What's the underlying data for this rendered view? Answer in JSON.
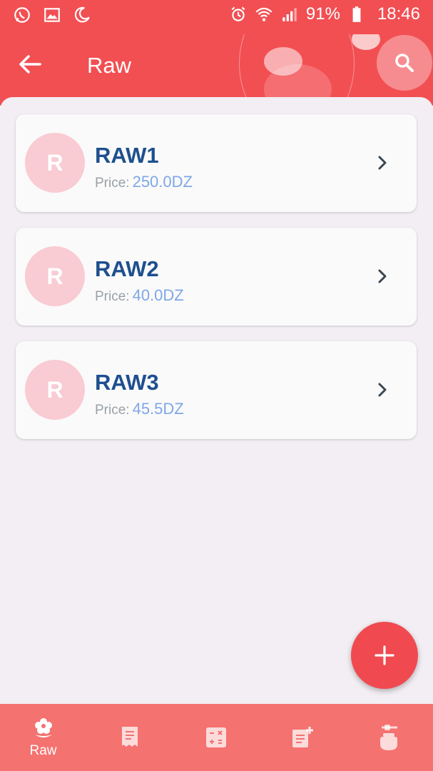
{
  "status_bar": {
    "battery": "91%",
    "time": "18:46",
    "left_icons": [
      "whatsapp-icon",
      "image-icon",
      "moon-icon"
    ],
    "right_icons": [
      "alarm-icon",
      "wifi-icon",
      "signal-icon",
      "battery-icon"
    ]
  },
  "app_bar": {
    "title": "Raw",
    "back_icon": "arrow-left-icon",
    "search_icon": "search-icon",
    "background": "#f24f53"
  },
  "items": [
    {
      "avatar": "R",
      "name": "RAW1",
      "price_label": "Price:",
      "price": "250.0DZ"
    },
    {
      "avatar": "R",
      "name": "RAW2",
      "price_label": "Price:",
      "price": "40.0DZ"
    },
    {
      "avatar": "R",
      "name": "RAW3",
      "price_label": "Price:",
      "price": "45.5DZ"
    }
  ],
  "fab": {
    "icon": "plus-icon"
  },
  "bottom_nav": {
    "items": [
      {
        "icon": "flower-icon",
        "label": "Raw",
        "active": true
      },
      {
        "icon": "receipt-icon",
        "label": ""
      },
      {
        "icon": "calculator-icon",
        "label": ""
      },
      {
        "icon": "note-add-icon",
        "label": ""
      },
      {
        "icon": "honey-pot-icon",
        "label": ""
      }
    ]
  },
  "colors": {
    "accent": "#f24f53",
    "title_text": "#1e4f8f",
    "price_text": "#7fa7e8",
    "avatar_bg": "#f9cbd3",
    "nav_bg": "#f4726f"
  }
}
